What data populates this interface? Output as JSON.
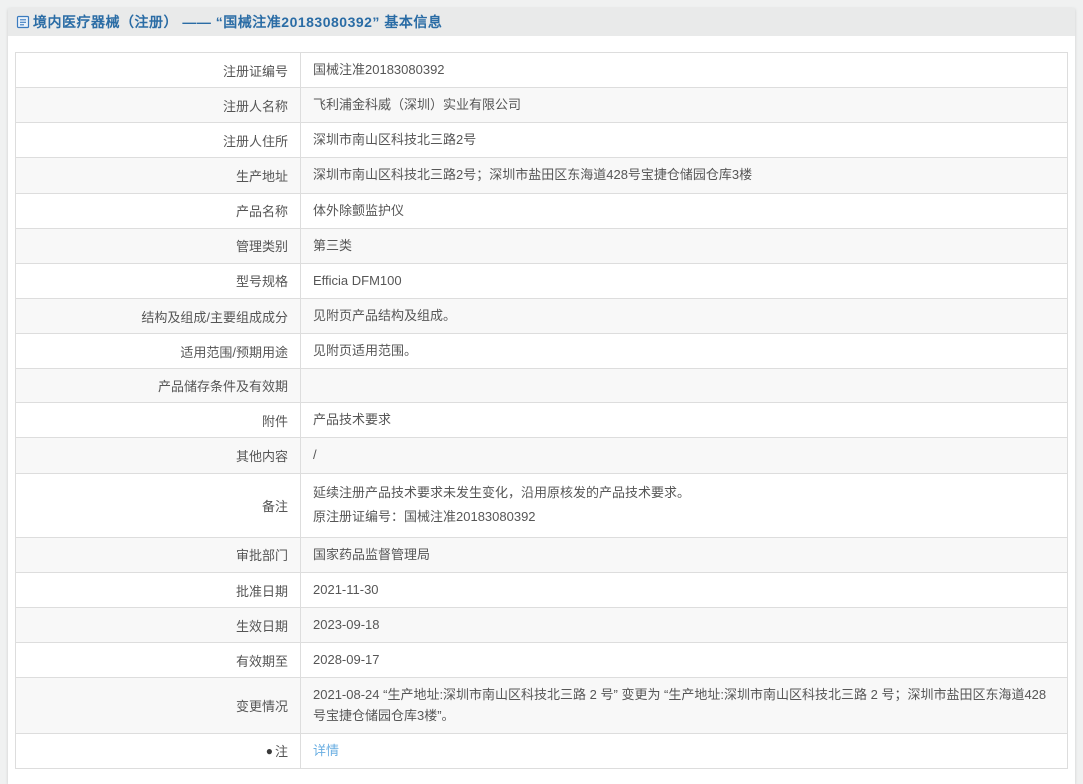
{
  "header": {
    "icon": "document-icon",
    "title": "境内医疗器械（注册） —— “国械注准20183080392” 基本信息"
  },
  "colors": {
    "title_blue": "#2a6ca5",
    "titlebar_bg": "#e9eaea",
    "page_bg": "#f0f1f1",
    "row_alt_bg": "#f8f8f8",
    "table_border": "#dddddd",
    "link_blue": "#6aaee2",
    "text_gray": "#565656"
  },
  "table": {
    "rows": [
      {
        "label": "注册证编号",
        "value": "国械注准20183080392"
      },
      {
        "label": "注册人名称",
        "value": "飞利浦金科威（深圳）实业有限公司"
      },
      {
        "label": "注册人住所",
        "value": "深圳市南山区科技北三路2号"
      },
      {
        "label": "生产地址",
        "value": "深圳市南山区科技北三路2号；深圳市盐田区东海道428号宝捷仓储园仓库3楼"
      },
      {
        "label": "产品名称",
        "value": "体外除颤监护仪"
      },
      {
        "label": "管理类别",
        "value": "第三类"
      },
      {
        "label": "型号规格",
        "value": "Efficia DFM100"
      },
      {
        "label": "结构及组成/主要组成成分",
        "value": "见附页产品结构及组成。"
      },
      {
        "label": "适用范围/预期用途",
        "value": "见附页适用范围。"
      },
      {
        "label": "产品储存条件及有效期",
        "value": ""
      },
      {
        "label": "附件",
        "value": "产品技术要求"
      },
      {
        "label": "其他内容",
        "value": "/"
      },
      {
        "label": "备注",
        "value": "延续注册产品技术要求未发生变化，沿用原核发的产品技术要求。",
        "value2": "原注册证编号：国械注准20183080392"
      },
      {
        "label": "审批部门",
        "value": "国家药品监督管理局"
      },
      {
        "label": "批准日期",
        "value": "2021-11-30"
      },
      {
        "label": "生效日期",
        "value": "2023-09-18"
      },
      {
        "label": "有效期至",
        "value": "2028-09-17"
      },
      {
        "label": "变更情况",
        "value": "2021-08-24 “生产地址:深圳市南山区科技北三路 2 号” 变更为 “生产地址:深圳市南山区科技北三路 2 号；深圳市盐田区东海道428号宝捷仓储园仓库3楼”。"
      },
      {
        "label": "注",
        "icon": "●",
        "value": "详情"
      }
    ]
  }
}
